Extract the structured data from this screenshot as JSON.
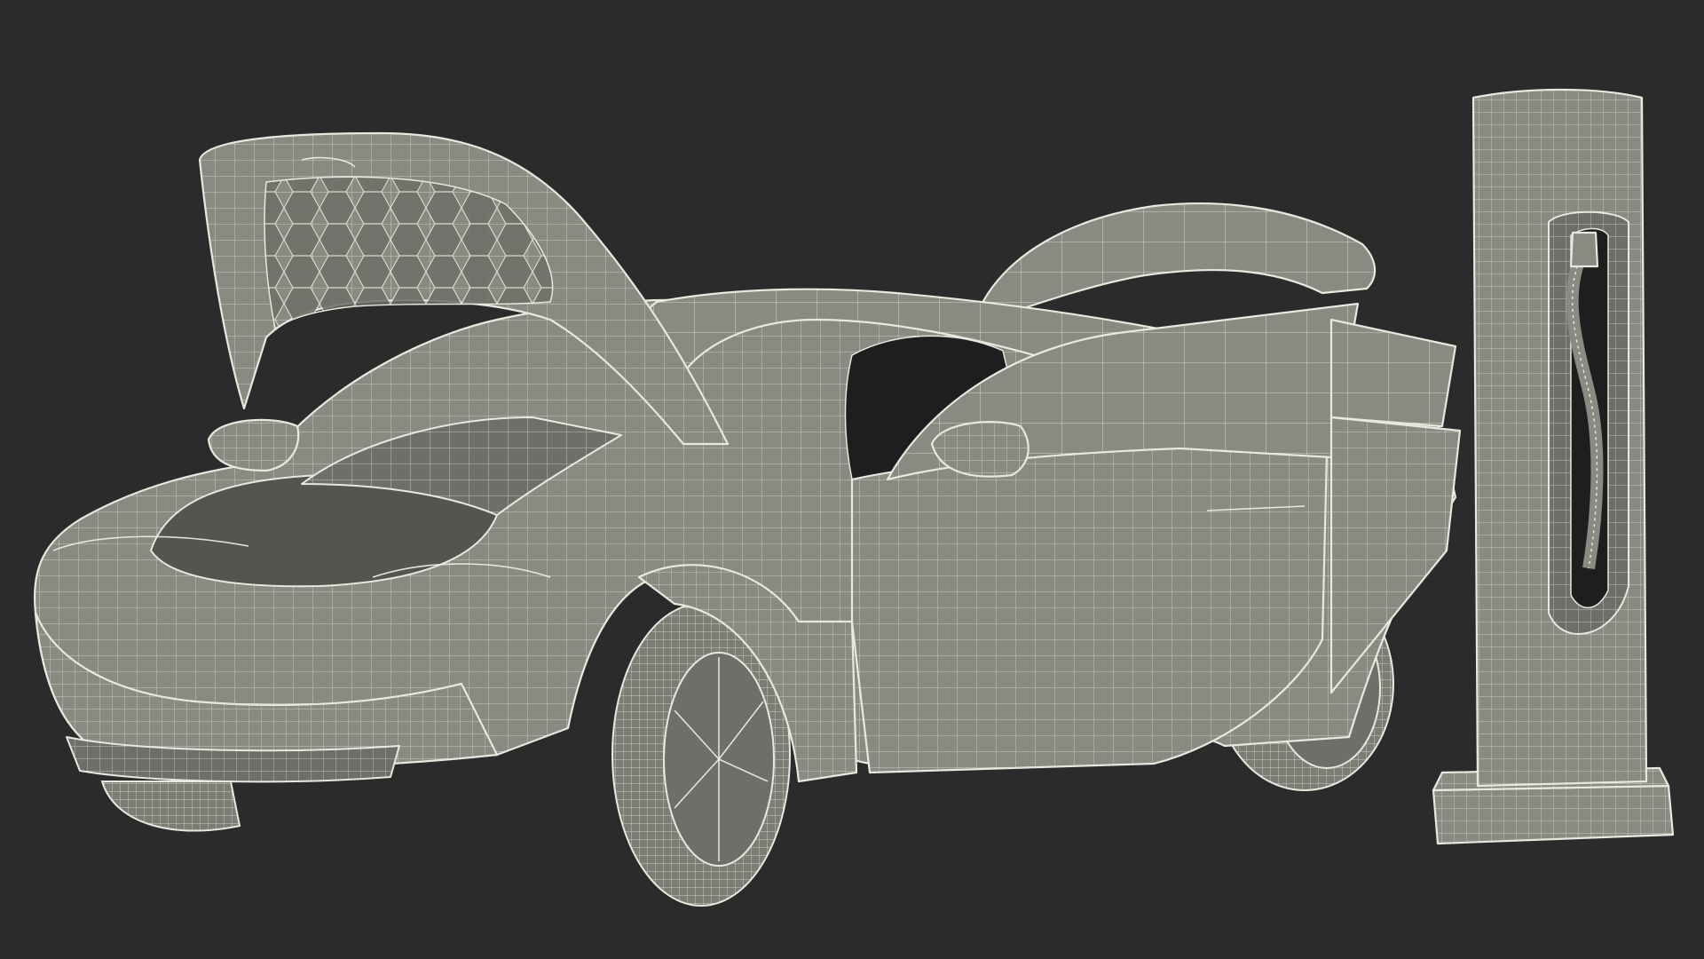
{
  "scene": {
    "background_color": "#2b2b2b",
    "surface_color": "#8a8a82",
    "wire_color": "#e8e8df",
    "objects": [
      {
        "name": "electric-sedan",
        "state": "frunk open, trunk open, front and rear doors open"
      },
      {
        "name": "charging-station",
        "state": "cable holstered"
      }
    ]
  }
}
